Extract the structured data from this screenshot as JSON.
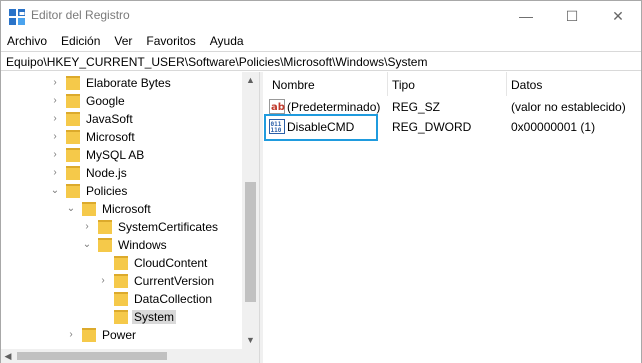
{
  "window": {
    "title": "Editor del Registro",
    "controls": {
      "minimize": "—",
      "maximize": "☐",
      "close": "✕"
    }
  },
  "menu": [
    "Archivo",
    "Edición",
    "Ver",
    "Favoritos",
    "Ayuda"
  ],
  "address": "Equipo\\HKEY_CURRENT_USER\\Software\\Policies\\Microsoft\\Windows\\System",
  "tree": [
    {
      "label": "Elaborate Bytes",
      "chevron": "›",
      "expanded": false
    },
    {
      "label": "Google",
      "chevron": "›",
      "expanded": false
    },
    {
      "label": "JavaSoft",
      "chevron": "›",
      "expanded": false
    },
    {
      "label": "Microsoft",
      "chevron": "›",
      "expanded": false
    },
    {
      "label": "MySQL AB",
      "chevron": "›",
      "expanded": false
    },
    {
      "label": "Node.js",
      "chevron": "›",
      "expanded": false
    },
    {
      "label": "Policies",
      "chevron": "⌄",
      "expanded": true
    },
    {
      "label": "Microsoft",
      "chevron": "⌄",
      "expanded": true
    },
    {
      "label": "SystemCertificates",
      "chevron": "›",
      "expanded": false
    },
    {
      "label": "Windows",
      "chevron": "⌄",
      "expanded": true
    },
    {
      "label": "CloudContent",
      "chevron": "",
      "expanded": false
    },
    {
      "label": "CurrentVersion",
      "chevron": "›",
      "expanded": false
    },
    {
      "label": "DataCollection",
      "chevron": "",
      "expanded": false
    },
    {
      "label": "System",
      "chevron": "",
      "expanded": false,
      "selected": true
    },
    {
      "label": "Power",
      "chevron": "›",
      "expanded": false
    }
  ],
  "list": {
    "columns": [
      "Nombre",
      "Tipo",
      "Datos"
    ],
    "rows": [
      {
        "icon": "string-value-icon",
        "name": "(Predeterminado)",
        "type": "REG_SZ",
        "data": "(valor no establecido)"
      },
      {
        "icon": "dword-value-icon",
        "name": "DisableCMD",
        "type": "REG_DWORD",
        "data": "0x00000001 (1)"
      }
    ]
  },
  "scroll": {
    "up": "▲",
    "down": "▼",
    "left": "◀"
  },
  "colors": {
    "folder": "#f5c94a",
    "folder_dark": "#dcaa2c",
    "selection": "#d9d9d9",
    "highlight": "#1f9bde"
  }
}
